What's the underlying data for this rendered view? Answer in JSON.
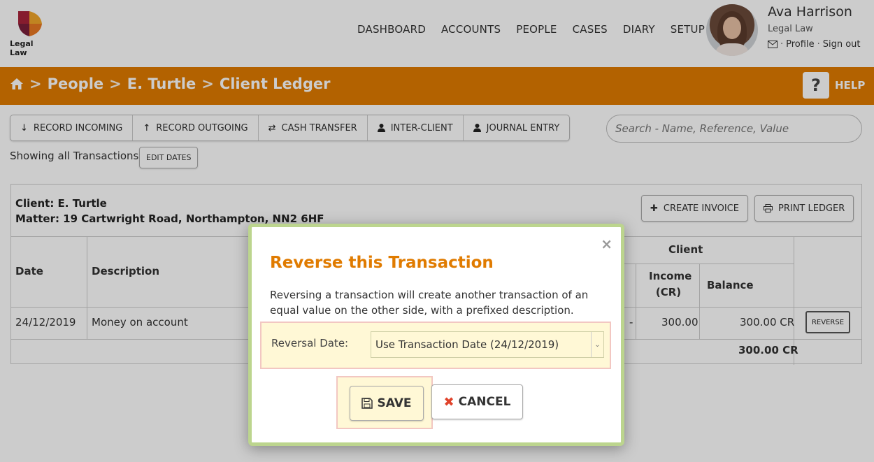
{
  "brand": {
    "name": "Legal Law"
  },
  "nav": [
    "DASHBOARD",
    "ACCOUNTS",
    "PEOPLE",
    "CASES",
    "DIARY",
    "SETUP"
  ],
  "user": {
    "name": "Ava Harrison",
    "org": "Legal Law",
    "profile": "Profile",
    "signout": "Sign out",
    "sep": "·"
  },
  "breadcrumb": {
    "sep": ">",
    "items": [
      "People",
      "E. Turtle",
      "Client Ledger"
    ]
  },
  "help": {
    "icon": "?",
    "label": "HELP"
  },
  "toolbar": {
    "record_incoming": "RECORD INCOMING",
    "record_outgoing": "RECORD OUTGOING",
    "cash_transfer": "CASH TRANSFER",
    "inter_client": "INTER-CLIENT",
    "journal_entry": "JOURNAL ENTRY"
  },
  "search": {
    "placeholder": "Search - Name, Reference, Value"
  },
  "filter": {
    "showing": "Showing all Transactions",
    "edit_dates": "EDIT DATES"
  },
  "ledger": {
    "client": "Client: E. Turtle",
    "matter": "Matter: 19 Cartwright Road, Northampton, NN2 6HF",
    "create_invoice": "CREATE INVOICE",
    "print_ledger": "PRINT LEDGER",
    "headers": {
      "date": "Date",
      "description": "Description",
      "client_group": "Client",
      "income_cr_1": "Income",
      "income_cr_2": "(CR)",
      "balance": "Balance"
    },
    "row": {
      "date": "24/12/2019",
      "description": "Money on account",
      "dash": "-",
      "income": "300.00",
      "balance": "300.00 CR",
      "reverse": "REVERSE"
    },
    "total": "300.00 CR"
  },
  "modal": {
    "close": "×",
    "title": "Reverse this Transaction",
    "text": "Reversing a transaction will create another transaction of an equal value on the other side, with a prefixed description.",
    "reversal_label": "Reversal Date:",
    "reversal_value": "Use Transaction Date (24/12/2019)",
    "save": "SAVE",
    "cancel": "CANCEL"
  },
  "colors": {
    "brand_orange": "#e07b00",
    "modal_border": "#bcd58e",
    "highlight": "#fff8d6",
    "cancel_x": "#e0432b"
  }
}
